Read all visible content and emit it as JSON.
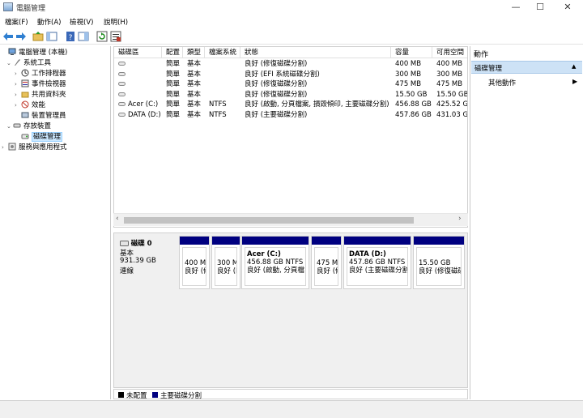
{
  "window": {
    "title": "電腦管理",
    "minimize": "—",
    "maximize": "☐",
    "close": "✕"
  },
  "menu": [
    {
      "label": "檔案(F)"
    },
    {
      "label": "動作(A)"
    },
    {
      "label": "檢視(V)"
    },
    {
      "label": "說明(H)"
    }
  ],
  "tree": [
    {
      "label": "電腦管理 (本機)",
      "icon": "computer-icon",
      "expander": ""
    },
    {
      "label": "系統工具",
      "icon": "tools-icon",
      "expander": "⌄"
    },
    {
      "label": "工作排程器",
      "icon": "clock-icon",
      "expander": "›"
    },
    {
      "label": "事件檢視器",
      "icon": "event-viewer-icon",
      "expander": "›"
    },
    {
      "label": "共用資料夾",
      "icon": "shared-folder-icon",
      "expander": "›"
    },
    {
      "label": "效能",
      "icon": "performance-icon",
      "expander": "›"
    },
    {
      "label": "裝置管理員",
      "icon": "device-manager-icon",
      "expander": ""
    },
    {
      "label": "存放裝置",
      "icon": "storage-icon",
      "expander": "⌄"
    },
    {
      "label": "磁碟管理",
      "icon": "disk-management-icon",
      "expander": ""
    },
    {
      "label": "服務與應用程式",
      "icon": "services-icon",
      "expander": "›"
    }
  ],
  "volumes": {
    "columns": [
      "磁碟區",
      "配置",
      "類型",
      "檔案系統",
      "狀態",
      "容量",
      "可用空間"
    ],
    "rows": [
      {
        "name": "",
        "layout": "簡單",
        "type": "基本",
        "fs": "",
        "status": "良好 (修復磁碟分割)",
        "capacity": "400 MB",
        "free": "400 MB"
      },
      {
        "name": "",
        "layout": "簡單",
        "type": "基本",
        "fs": "",
        "status": "良好 (EFI 系統磁碟分割)",
        "capacity": "300 MB",
        "free": "300 MB"
      },
      {
        "name": "",
        "layout": "簡單",
        "type": "基本",
        "fs": "",
        "status": "良好 (修復磁碟分割)",
        "capacity": "475 MB",
        "free": "475 MB"
      },
      {
        "name": "",
        "layout": "簡單",
        "type": "基本",
        "fs": "",
        "status": "良好 (修復磁碟分割)",
        "capacity": "15.50 GB",
        "free": "15.50 GB"
      },
      {
        "name": "Acer (C:)",
        "layout": "簡單",
        "type": "基本",
        "fs": "NTFS",
        "status": "良好 (啟動, 分頁檔案, 損毀傾印, 主要磁碟分割)",
        "capacity": "456.88 GB",
        "free": "425.52 G"
      },
      {
        "name": "DATA (D:)",
        "layout": "簡單",
        "type": "基本",
        "fs": "NTFS",
        "status": "良好 (主要磁碟分割)",
        "capacity": "457.86 GB",
        "free": "431.03 G"
      }
    ]
  },
  "disk": {
    "name": "磁碟 0",
    "type": "基本",
    "size": "931.39 GB",
    "state": "連線",
    "partitions": [
      {
        "title": "",
        "size": "400 MI",
        "status": "良好 (修"
      },
      {
        "title": "",
        "size": "300 M",
        "status": "良好 (E"
      },
      {
        "title": "Acer  (C:)",
        "size": "456.88 GB NTFS",
        "status": "良好 (啟動, 分頁檔"
      },
      {
        "title": "",
        "size": "475 MI",
        "status": "良好 (修"
      },
      {
        "title": "DATA  (D:)",
        "size": "457.86 GB NTFS",
        "status": "良好 (主要磁碟分割"
      },
      {
        "title": "",
        "size": "15.50 GB",
        "status": "良好 (修復磁碟分"
      }
    ]
  },
  "legend": [
    {
      "label": "未配置",
      "color": "#000000"
    },
    {
      "label": "主要磁碟分割",
      "color": "#000080"
    }
  ],
  "actions": {
    "title": "動作",
    "section": "磁碟管理",
    "item": "其他動作"
  }
}
